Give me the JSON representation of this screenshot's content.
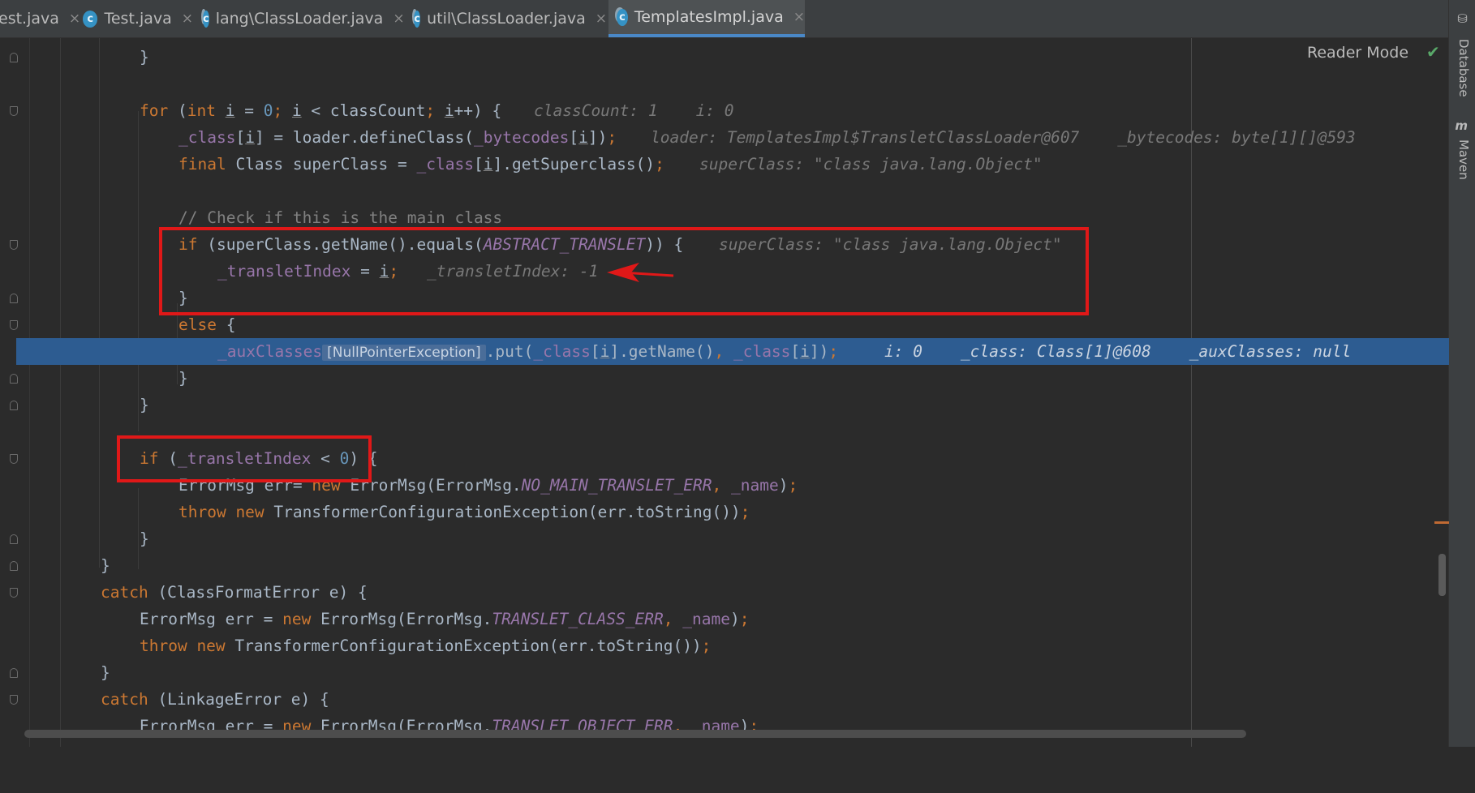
{
  "tabs": [
    {
      "label": "est.java",
      "icon": "none",
      "active": false
    },
    {
      "label": "Test.java",
      "icon": "class-icon",
      "active": false
    },
    {
      "label": "lang\\ClassLoader.java",
      "icon": "library-class-icon",
      "active": false
    },
    {
      "label": "util\\ClassLoader.java",
      "icon": "library-class-icon",
      "active": false
    },
    {
      "label": "TemplatesImpl.java",
      "icon": "library-class-icon",
      "active": true
    }
  ],
  "tab_close_glyph": "×",
  "class_icon_letter": "c",
  "editor": {
    "reader_mode": "Reader Mode",
    "exception_badge": "[NullPointerException]"
  },
  "right_panel": {
    "database": "Database",
    "maven": "Maven"
  },
  "colors": {
    "background": "#2b2b2b",
    "keyword": "#cc7832",
    "field": "#9876aa",
    "number": "#6897bb",
    "execution_line": "#2d5c91",
    "annotation_red": "#e01818"
  },
  "code": {
    "l01": "}",
    "l02": "for (int i = 0; i < classCount; i++) {",
    "l02_hint": "classCount: 1    i: 0",
    "l03": "_class[i] = loader.defineClass(_bytecodes[i]);",
    "l03_hint": "loader: TemplatesImpl$TransletClassLoader@607    _bytecodes: byte[1][]@593",
    "l04": "final Class superClass = _class[i].getSuperclass();",
    "l04_hint": "superClass: \"class java.lang.Object\"",
    "l05": "// Check if this is the main class",
    "l06": "if (superClass.getName().equals(ABSTRACT_TRANSLET)) {",
    "l06_hint": "superClass: \"class java.lang.Object\"",
    "l07": "_transletIndex = i;",
    "l07_hint": "_transletIndex: -1",
    "l08": "}",
    "l09": "else {",
    "l10": "_auxClasses[NullPointerException].put(_class[i].getName(), _class[i]);",
    "l10_hint": "i: 0    _class: Class[1]@608    _auxClasses: null",
    "l11": "}",
    "l12": "}",
    "l13": "if (_transletIndex < 0) {",
    "l14": "ErrorMsg err= new ErrorMsg(ErrorMsg.NO_MAIN_TRANSLET_ERR, _name);",
    "l15": "throw new TransformerConfigurationException(err.toString());",
    "l16": "}",
    "l17": "}",
    "l18": "catch (ClassFormatError e) {",
    "l19": "ErrorMsg err = new ErrorMsg(ErrorMsg.TRANSLET_CLASS_ERR, _name);",
    "l20": "throw new TransformerConfigurationException(err.toString());",
    "l21": "}",
    "l22": "catch (LinkageError e) {",
    "l23": "ErrorMsg err = new ErrorMsg(ErrorMsg.TRANSLET_OBJECT_ERR, _name);"
  }
}
